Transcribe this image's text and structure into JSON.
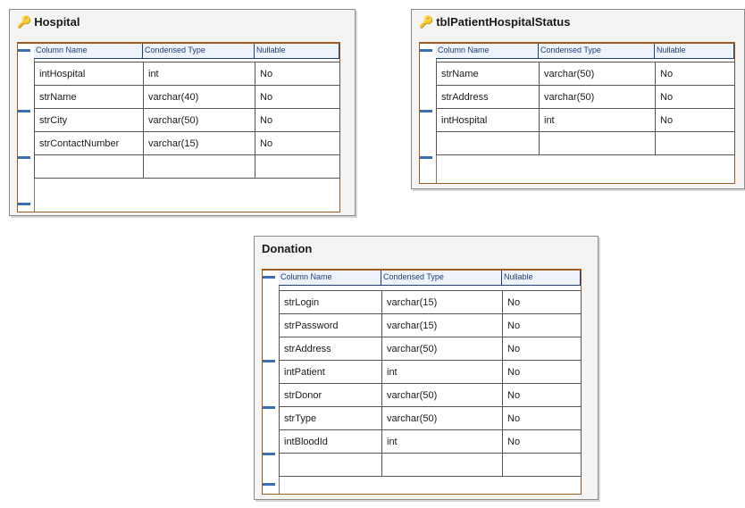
{
  "column_headers": [
    "Column Name",
    "Condensed Type",
    "Nullable"
  ],
  "tables": [
    {
      "title": "Hospital",
      "rows": [
        {
          "name": "intHospital",
          "type": "int",
          "nullable": "No",
          "pk": true
        },
        {
          "name": "strName",
          "type": "varchar(40)",
          "nullable": "No",
          "pk": false
        },
        {
          "name": "strCity",
          "type": "varchar(50)",
          "nullable": "No",
          "pk": false
        },
        {
          "name": "strContactNumber",
          "type": "varchar(15)",
          "nullable": "No",
          "pk": false
        },
        {
          "name": "",
          "type": "",
          "nullable": "",
          "pk": false
        }
      ]
    },
    {
      "title": "tblPatientHospitalStatus",
      "rows": [
        {
          "name": "strName",
          "type": "varchar(50)",
          "nullable": "No",
          "pk": true
        },
        {
          "name": "strAddress",
          "type": "varchar(50)",
          "nullable": "No",
          "pk": false
        },
        {
          "name": "intHospital",
          "type": "int",
          "nullable": "No",
          "pk": false
        },
        {
          "name": "",
          "type": "",
          "nullable": "",
          "pk": false
        }
      ]
    },
    {
      "title": "Donation",
      "rows": [
        {
          "name": "strLogin",
          "type": "varchar(15)",
          "nullable": "No",
          "pk": true
        },
        {
          "name": "strPassword",
          "type": "varchar(15)",
          "nullable": "No",
          "pk": true
        },
        {
          "name": "strAddress",
          "type": "varchar(50)",
          "nullable": "No",
          "pk": false
        },
        {
          "name": "intPatient",
          "type": "int",
          "nullable": "No",
          "pk": false
        },
        {
          "name": "strDonor",
          "type": "varchar(50)",
          "nullable": "No",
          "pk": false
        },
        {
          "name": "strType",
          "type": "varchar(50)",
          "nullable": "No",
          "pk": false
        },
        {
          "name": "intBloodId",
          "type": "int",
          "nullable": "No",
          "pk": false
        },
        {
          "name": "",
          "type": "",
          "nullable": "",
          "pk": false
        }
      ]
    }
  ]
}
